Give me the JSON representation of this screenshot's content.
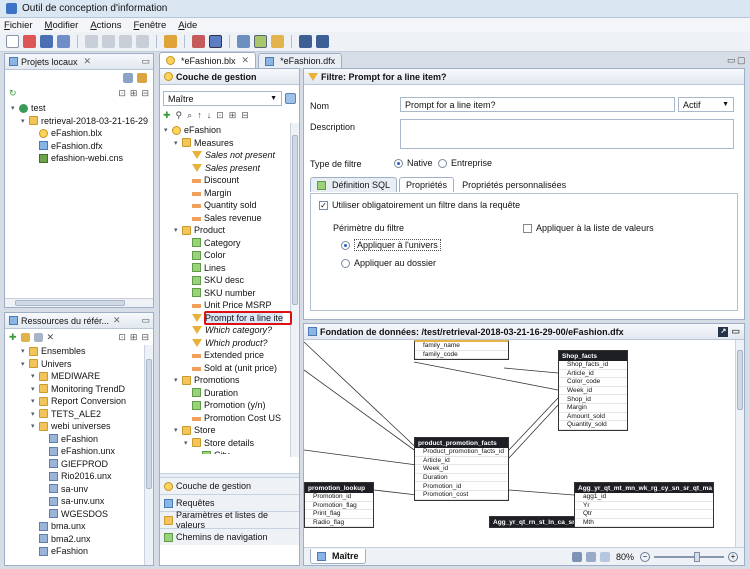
{
  "app": {
    "title": "Outil de conception d'information"
  },
  "menu": [
    "Fichier",
    "Modifier",
    "Actions",
    "Fenêtre",
    "Aide"
  ],
  "left_top": {
    "title": "Projets locaux",
    "tree": [
      {
        "label": "test",
        "level": 0,
        "icon": "project"
      },
      {
        "label": "retrieval-2018-03-21-16-29",
        "level": 1,
        "icon": "folder"
      },
      {
        "label": "eFashion.blx",
        "level": 2,
        "icon": "blx"
      },
      {
        "label": "eFashion.dfx",
        "level": 2,
        "icon": "dfx"
      },
      {
        "label": "efashion-webi.cns",
        "level": 2,
        "icon": "cns"
      }
    ]
  },
  "left_bottom": {
    "title": "Ressources du référ...",
    "tree": [
      {
        "label": "Ensembles",
        "level": 1,
        "icon": "folder"
      },
      {
        "label": "Univers",
        "level": 1,
        "icon": "folder"
      },
      {
        "label": "MEDIWARE",
        "level": 2,
        "icon": "folder"
      },
      {
        "label": "Monitoring TrendD",
        "level": 2,
        "icon": "folder"
      },
      {
        "label": "Report Conversion",
        "level": 2,
        "icon": "folder"
      },
      {
        "label": "TETS_ALE2",
        "level": 2,
        "icon": "folder"
      },
      {
        "label": "webi universes",
        "level": 2,
        "icon": "folder"
      },
      {
        "label": "eFashion",
        "level": 3,
        "icon": "unx"
      },
      {
        "label": "eFashion.unx",
        "level": 3,
        "icon": "unx"
      },
      {
        "label": "GIEFPROD",
        "level": 3,
        "icon": "unx"
      },
      {
        "label": "Rio2016.unx",
        "level": 3,
        "icon": "unx"
      },
      {
        "label": "sa-unv",
        "level": 3,
        "icon": "unx"
      },
      {
        "label": "sa-unv.unx",
        "level": 3,
        "icon": "unx"
      },
      {
        "label": "WGESDOS",
        "level": 3,
        "icon": "unx"
      },
      {
        "label": "bma.unx",
        "level": 2,
        "icon": "unx"
      },
      {
        "label": "bma2.unx",
        "level": 2,
        "icon": "unx"
      },
      {
        "label": "eFashion",
        "level": 2,
        "icon": "unx"
      }
    ]
  },
  "editor_tabs": [
    "*eFashion.blx",
    "*eFashion.dfx"
  ],
  "business_layer": {
    "title": "Couche de gestion",
    "view": "Maître",
    "tree": [
      {
        "label": "eFashion",
        "level": 0,
        "icon": "blx",
        "style": ""
      },
      {
        "label": "Measures",
        "level": 1,
        "icon": "folder",
        "style": ""
      },
      {
        "label": "Sales not present",
        "level": 2,
        "icon": "filter",
        "style": "italic"
      },
      {
        "label": "Sales present",
        "level": 2,
        "icon": "filter",
        "style": "italic"
      },
      {
        "label": "Discount",
        "level": 2,
        "icon": "measure",
        "style": ""
      },
      {
        "label": "Margin",
        "level": 2,
        "icon": "measure",
        "style": ""
      },
      {
        "label": "Quantity sold",
        "level": 2,
        "icon": "measure",
        "style": ""
      },
      {
        "label": "Sales revenue",
        "level": 2,
        "icon": "measure",
        "style": ""
      },
      {
        "label": "Product",
        "level": 1,
        "icon": "folder",
        "style": ""
      },
      {
        "label": "Category",
        "level": 2,
        "icon": "dim",
        "style": ""
      },
      {
        "label": "Color",
        "level": 2,
        "icon": "dim",
        "style": ""
      },
      {
        "label": "Lines",
        "level": 2,
        "icon": "dim",
        "style": ""
      },
      {
        "label": "SKU desc",
        "level": 2,
        "icon": "dim",
        "style": ""
      },
      {
        "label": "SKU number",
        "level": 2,
        "icon": "dim",
        "style": ""
      },
      {
        "label": "Unit Price MSRP",
        "level": 2,
        "icon": "measure",
        "style": ""
      },
      {
        "label": "Prompt for a line ite",
        "level": 2,
        "icon": "filter",
        "style": "selected"
      },
      {
        "label": "Which category?",
        "level": 2,
        "icon": "filter",
        "style": "italic"
      },
      {
        "label": "Which product?",
        "level": 2,
        "icon": "filter",
        "style": "italic"
      },
      {
        "label": "Extended price",
        "level": 2,
        "icon": "measure",
        "style": ""
      },
      {
        "label": "Sold at (unit price)",
        "level": 2,
        "icon": "measure",
        "style": ""
      },
      {
        "label": "Promotions",
        "level": 1,
        "icon": "folder",
        "style": ""
      },
      {
        "label": "Duration",
        "level": 2,
        "icon": "dim",
        "style": ""
      },
      {
        "label": "Promotion (y/n)",
        "level": 2,
        "icon": "dim",
        "style": ""
      },
      {
        "label": "Promotion Cost US",
        "level": 2,
        "icon": "measure",
        "style": ""
      },
      {
        "label": "Store",
        "level": 1,
        "icon": "folder",
        "style": ""
      },
      {
        "label": "Store details",
        "level": 2,
        "icon": "folder",
        "style": ""
      },
      {
        "label": "City",
        "level": 3,
        "icon": "dim",
        "style": ""
      }
    ],
    "nav": [
      "Couche de gestion",
      "Requêtes",
      "Paramètres et listes de valeurs",
      "Chemins de navigation"
    ]
  },
  "filter": {
    "header": "Filtre: Prompt for a line item?",
    "name_label": "Nom",
    "name_value": "Prompt for a line item?",
    "state": "Actif",
    "desc_label": "Description",
    "type_label": "Type de filtre",
    "type_options": [
      "Native",
      "Entreprise"
    ],
    "tabs": [
      "Définition SQL",
      "Propriétés",
      "Propriétés personnalisées"
    ],
    "mandatory_label": "Utiliser obligatoirement un filtre dans la requête",
    "scope_label": "Périmètre du filtre",
    "scope_options": [
      "Appliquer à l'univers",
      "Appliquer au dossier"
    ],
    "lov_label": "Appliquer à la liste de valeurs"
  },
  "foundation": {
    "header": "Fondation de données: /test/retrieval-2018-03-21-16-29-00/eFashion.dfx",
    "tables": [
      {
        "name": "",
        "cols": [
          "family_name",
          "family_code"
        ]
      },
      {
        "name": "Shop_facts",
        "cols": [
          "Shop_facts_id",
          "Article_id",
          "Color_code",
          "Week_id",
          "Shop_id",
          "Margin",
          "Amount_sold",
          "Quantity_sold"
        ]
      },
      {
        "name": "product_promotion_facts",
        "cols": [
          "Product_promotion_facts_id",
          "Article_id",
          "Week_id",
          "Duration",
          "Promotion_id",
          "Promotion_cost"
        ]
      },
      {
        "name": "promotion_lookup",
        "cols": [
          "Promotion_id",
          "Promotion_flag",
          "Print_flag",
          "Radio_flag"
        ]
      },
      {
        "name": "Agg_yr_qt_rn_st_ln_ca_sr",
        "cols": []
      },
      {
        "name": "Agg_yr_qt_mt_mn_wk_rg_cy_sn_sr_qt_ma",
        "cols": [
          "agg1_id",
          "Yr",
          "Qtr",
          "Mth"
        ]
      }
    ],
    "bottom_tab": "Maître",
    "zoom": "80%"
  }
}
